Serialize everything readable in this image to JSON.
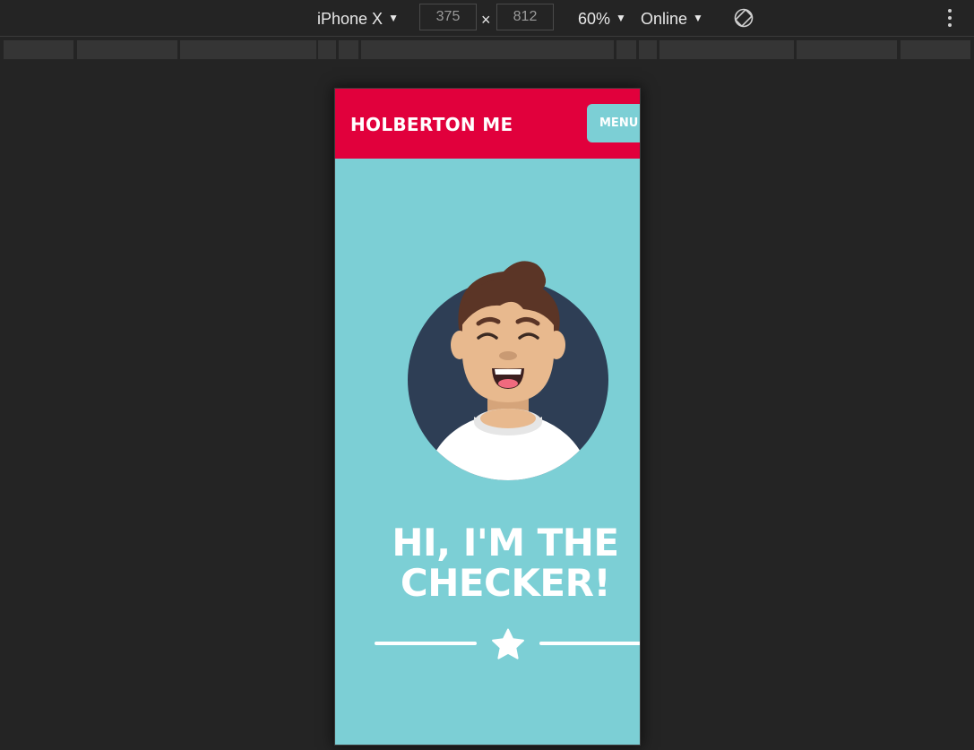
{
  "devtools": {
    "device_name": "iPhone X",
    "width_value": "375",
    "times_symbol": "×",
    "height_value": "812",
    "zoom": "60%",
    "network": "Online",
    "icons": {
      "dropdown": "caret-down-icon",
      "rotate": "rotate-icon",
      "more": "kebab-menu-icon"
    }
  },
  "page": {
    "header": {
      "logo_text": "HOLBERTON ME",
      "menu_label": "MENU",
      "background_color": "#e1003c"
    },
    "hero": {
      "title_line1": "HI, I'M THE",
      "title_line2": "CHECKER!",
      "background_color": "#7ccfd5",
      "avatar_icon": "smiling-person-avatar-icon",
      "divider_icon": "star-icon"
    }
  }
}
